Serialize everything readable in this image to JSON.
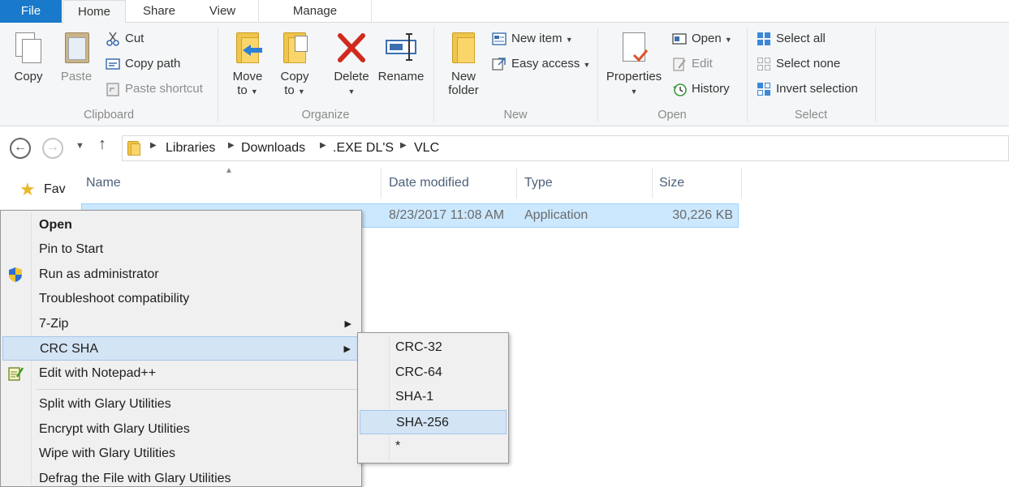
{
  "ribbon_tabs": {
    "file": "File",
    "home": "Home",
    "share": "Share",
    "view": "View",
    "manage": "Manage"
  },
  "clipboard": {
    "copy": "Copy",
    "paste": "Paste",
    "cut": "Cut",
    "copy_path": "Copy path",
    "paste_shortcut": "Paste shortcut",
    "group_label": "Clipboard"
  },
  "organize": {
    "move_to_line1": "Move",
    "move_to_line2": "to",
    "copy_to_line1": "Copy",
    "copy_to_line2": "to",
    "delete": "Delete",
    "rename": "Rename",
    "group_label": "Organize"
  },
  "new_group": {
    "new_folder_line1": "New",
    "new_folder_line2": "folder",
    "new_item": "New item",
    "easy_access": "Easy access",
    "group_label": "New"
  },
  "open_group": {
    "properties": "Properties",
    "open": "Open",
    "edit": "Edit",
    "history": "History",
    "group_label": "Open"
  },
  "select_group": {
    "select_all": "Select all",
    "select_none": "Select none",
    "invert_selection": "Invert selection",
    "group_label": "Select"
  },
  "address": {
    "crumbs": [
      "Libraries",
      "Downloads",
      ".EXE DL'S",
      "VLC"
    ]
  },
  "nav_pane": {
    "favorites_partial": "Fav"
  },
  "columns": {
    "name": "Name",
    "date_modified": "Date modified",
    "type": "Type",
    "size": "Size"
  },
  "file_row": {
    "date_modified": "8/23/2017 11:08 AM",
    "type": "Application",
    "size": "30,226 KB"
  },
  "context_menu": {
    "items": [
      "Open",
      "Pin to Start",
      "Run as administrator",
      "Troubleshoot compatibility",
      "7-Zip",
      "CRC SHA",
      "Edit with Notepad++",
      "Split with Glary Utilities",
      "Encrypt with Glary Utilities",
      "Wipe with Glary Utilities",
      "Defrag the File with Glary Utilities"
    ],
    "highlighted": "CRC SHA"
  },
  "submenu": {
    "items": [
      "CRC-32",
      "CRC-64",
      "SHA-1",
      "SHA-256",
      "*"
    ],
    "highlighted": "SHA-256"
  },
  "icons": {
    "copy": "copy-icon",
    "paste": "paste-icon",
    "cut": "scissors-icon",
    "copy_path": "copy-path-icon",
    "paste_shortcut": "paste-shortcut-icon",
    "move_to": "move-to-icon",
    "copy_to": "copy-to-icon",
    "delete": "delete-x-icon",
    "rename": "rename-icon",
    "new_folder": "folder-icon",
    "new_item": "new-item-icon",
    "easy_access": "easy-access-icon",
    "properties": "properties-icon",
    "open": "open-icon",
    "edit": "edit-icon",
    "history": "history-icon",
    "select_all": "select-all-icon",
    "select_none": "select-none-icon",
    "invert_selection": "invert-selection-icon",
    "uac_shield": "shield-icon",
    "notepad": "notepad-icon",
    "favorites": "star-icon"
  },
  "colors": {
    "file_tab": "#1979ca",
    "selection": "#cce8ff",
    "menu_highlight": "#d3e4f5",
    "ribbon_bg": "#f5f6f7"
  }
}
